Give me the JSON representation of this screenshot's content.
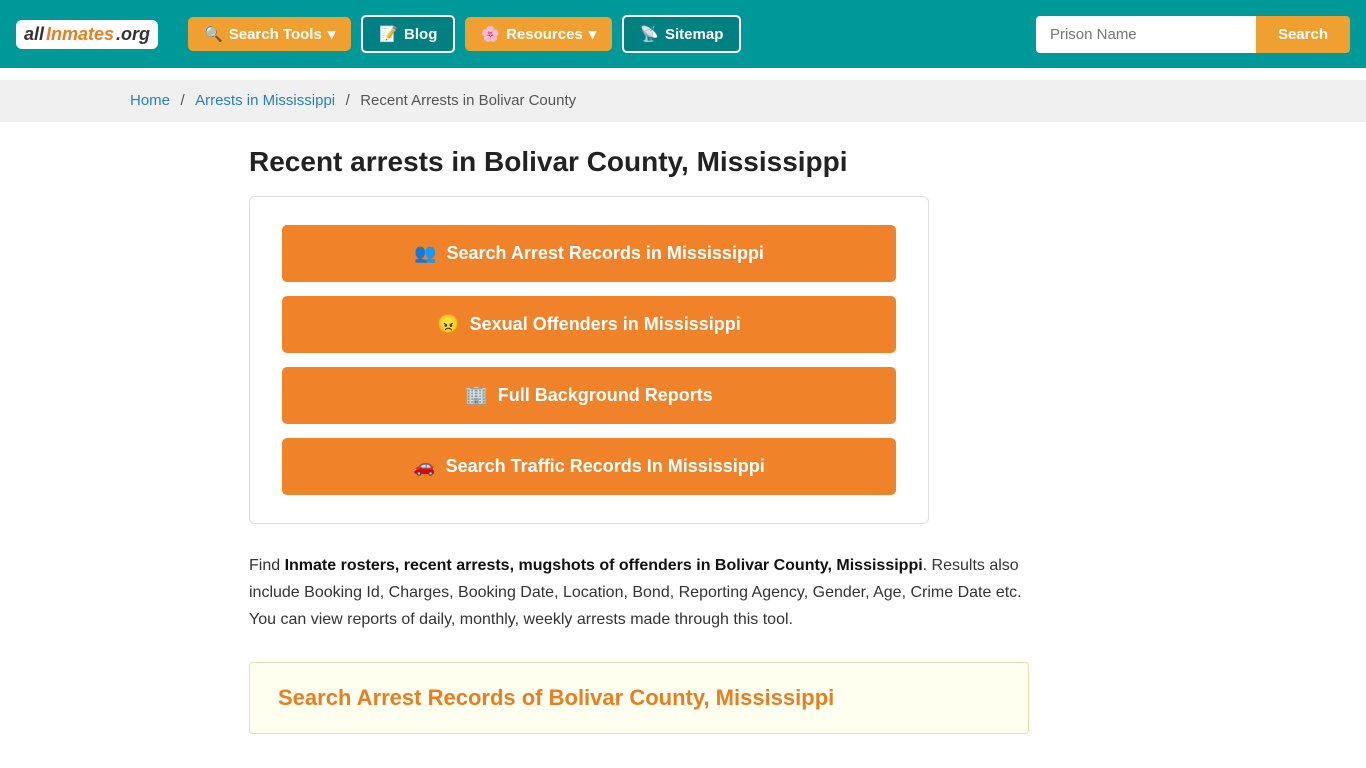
{
  "site": {
    "logo_all": "all",
    "logo_inmates": "Inmates",
    "logo_org": ".org"
  },
  "navbar": {
    "search_tools_label": "Search Tools",
    "blog_label": "Blog",
    "resources_label": "Resources",
    "sitemap_label": "Sitemap",
    "prison_name_placeholder": "Prison Name",
    "search_button_label": "Search"
  },
  "breadcrumb": {
    "home": "Home",
    "arrests": "Arrests in Mississippi",
    "current": "Recent Arrests in Bolivar County"
  },
  "main": {
    "page_title": "Recent arrests in Bolivar County, Mississippi",
    "buttons": [
      {
        "label": "Search Arrest Records in Mississippi",
        "icon": "👥"
      },
      {
        "label": "Sexual Offenders in Mississippi",
        "icon": "😠"
      },
      {
        "label": "Full Background Reports",
        "icon": "🏢"
      },
      {
        "label": "Search Traffic Records In Mississippi",
        "icon": "🚗"
      }
    ],
    "description_intro": "Find ",
    "description_bold": "Inmate rosters, recent arrests, mugshots of offenders in Bolivar County, Mississippi",
    "description_rest": ". Results also include Booking Id, Charges, Booking Date, Location, Bond, Reporting Agency, Gender, Age, Crime Date etc. You can view reports of daily, monthly, weekly arrests made through this tool.",
    "search_section_title": "Search Arrest Records of Bolivar County, Mississippi"
  }
}
